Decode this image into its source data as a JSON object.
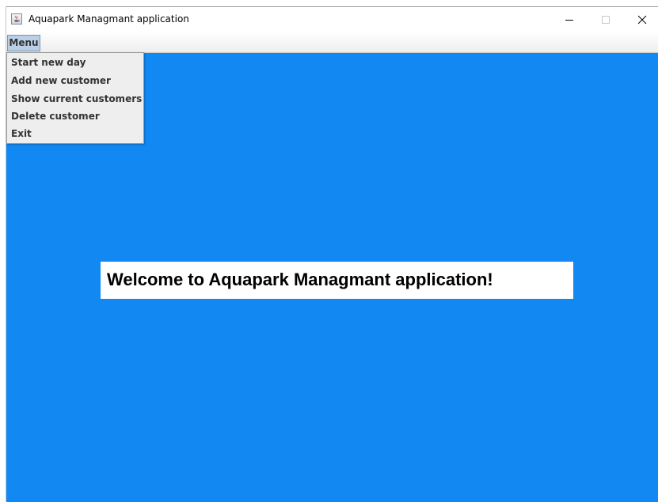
{
  "window": {
    "title": "Aquapark Managmant application",
    "icon": "java-cup-icon",
    "controls": {
      "minimize_icon": "minimize-icon",
      "maximize_icon": "maximize-icon",
      "close_icon": "close-icon"
    }
  },
  "menubar": {
    "menu_label": "Menu"
  },
  "menu": {
    "items": [
      {
        "label": "Start new day"
      },
      {
        "label": "Add new customer"
      },
      {
        "label": "Show current customers"
      },
      {
        "label": "Delete customer"
      },
      {
        "label": "Exit"
      }
    ]
  },
  "main": {
    "welcome_text": "Welcome to Aquapark Managmant application!",
    "background_color": "#1188f2"
  }
}
